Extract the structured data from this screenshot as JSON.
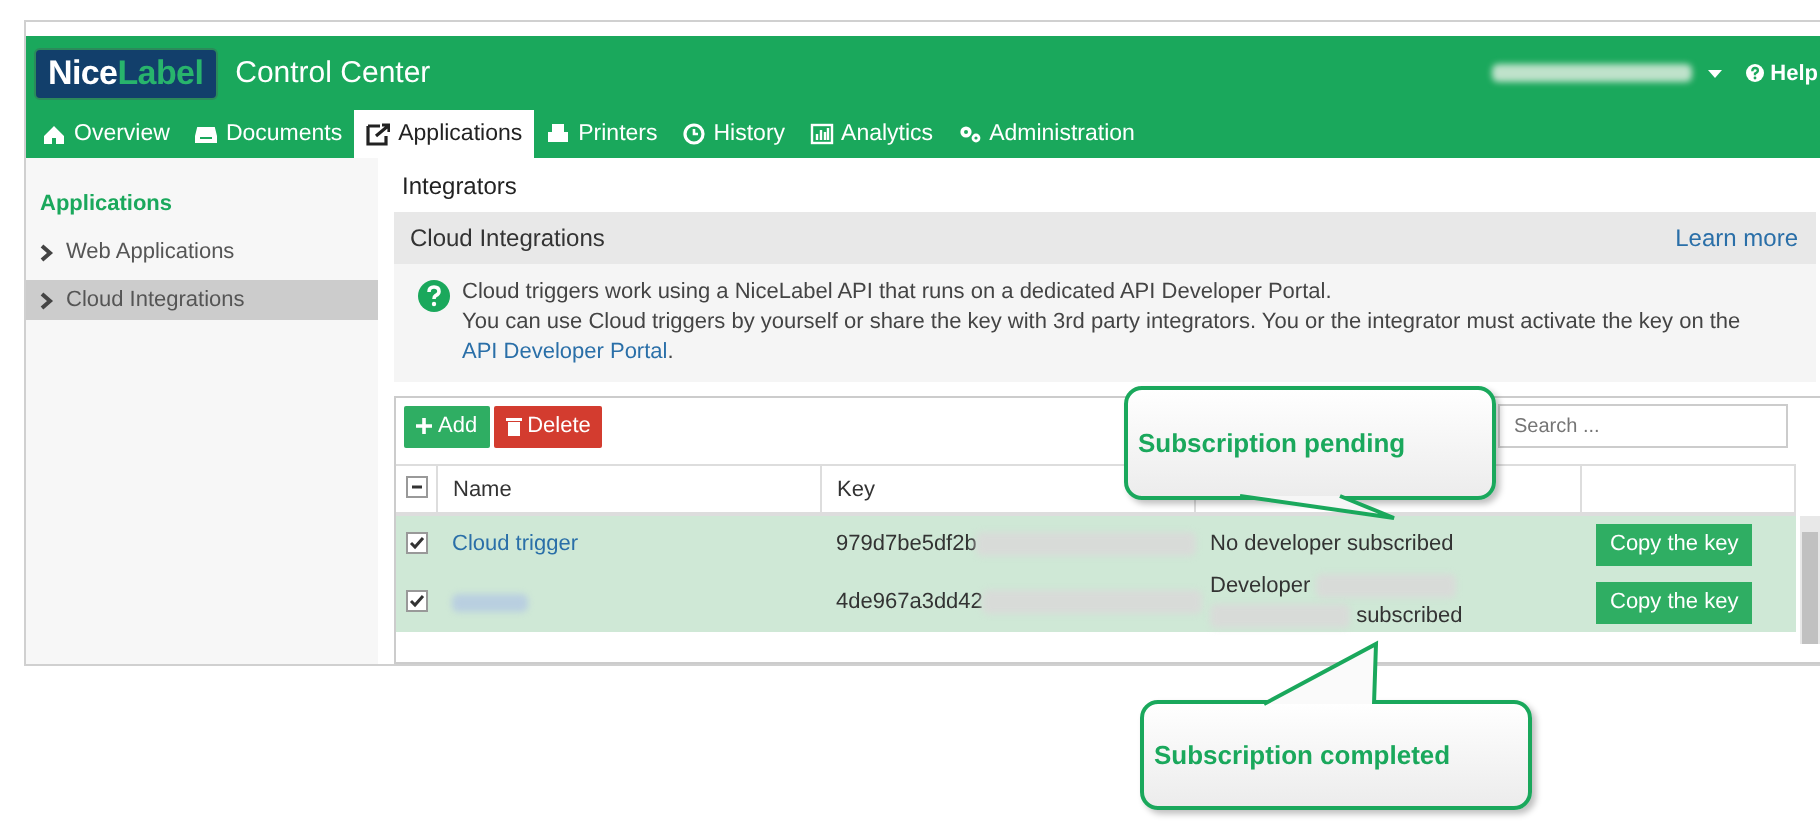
{
  "header": {
    "logo": {
      "part1": "Nice",
      "part2": "Label"
    },
    "title": "Control Center",
    "help": "Help"
  },
  "tabs": [
    {
      "label": "Overview",
      "selected": false
    },
    {
      "label": "Documents",
      "selected": false
    },
    {
      "label": "Applications",
      "selected": true
    },
    {
      "label": "Printers",
      "selected": false
    },
    {
      "label": "History",
      "selected": false
    },
    {
      "label": "Analytics",
      "selected": false
    },
    {
      "label": "Administration",
      "selected": false
    }
  ],
  "sidebar": {
    "heading": "Applications",
    "items": [
      {
        "label": "Web Applications",
        "selected": false
      },
      {
        "label": "Cloud Integrations",
        "selected": true
      }
    ]
  },
  "page_title": "Integrators",
  "section": {
    "title": "Cloud Integrations",
    "link": "Learn more"
  },
  "info": {
    "line1": "Cloud triggers work using a NiceLabel API that runs on a dedicated API Developer Portal.",
    "line2": "You can use Cloud triggers by yourself or share the key with 3rd party integrators. You or the integrator must activate the key on the",
    "link": "API Developer Portal",
    "end": "."
  },
  "toolbar": {
    "add": "Add",
    "delete": "Delete",
    "search": {
      "placeholder": "Search ..."
    }
  },
  "table": {
    "select_all": {
      "indeterminate": true
    },
    "columns": [
      "Name",
      "Key"
    ],
    "rows": [
      {
        "checked": true,
        "name": "Cloud trigger",
        "name_redacted": false,
        "key": "979d7be5df2b",
        "status": [
          {
            "kind": "text",
            "text": "No developer subscribed"
          }
        ],
        "action": "Copy the key"
      },
      {
        "checked": true,
        "name": "",
        "name_redacted": true,
        "key": "4de967a3dd42",
        "status": [
          {
            "kind": "text",
            "text": "Developer"
          },
          {
            "kind": "redacted"
          },
          {
            "kind": "redacted"
          },
          {
            "kind": "text",
            "text": "subscribed"
          }
        ],
        "action": "Copy the key"
      }
    ]
  },
  "callouts": [
    {
      "text": "Subscription pending"
    },
    {
      "text": "Subscription completed"
    }
  ]
}
